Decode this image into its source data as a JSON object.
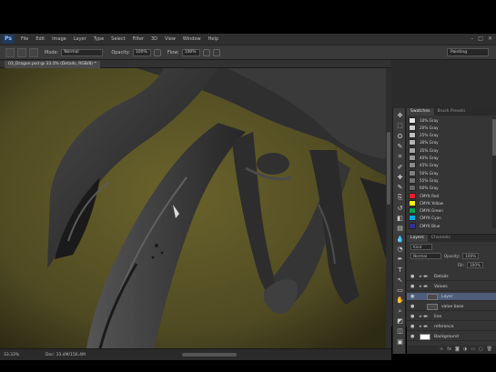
{
  "app": {
    "logo": "Ps",
    "menu": [
      "File",
      "Edit",
      "Image",
      "Layer",
      "Type",
      "Select",
      "Filter",
      "3D",
      "View",
      "Window",
      "Help"
    ],
    "window_controls": [
      "–",
      "□",
      "✕"
    ]
  },
  "options_bar": {
    "mode_label": "Mode:",
    "mode_value": "Normal",
    "opacity_label": "Opacity:",
    "opacity_value": "100%",
    "flow_label": "Flow:",
    "flow_value": "100%",
    "workspace": "Painting"
  },
  "document": {
    "tab_title": "03_Dragon.psd @ 33.3% (Details, RGB/8) *"
  },
  "status": {
    "zoom": "33.33%",
    "doc_size": "Doc: 33.4M/156.4M"
  },
  "tools": [
    "move-icon",
    "marquee-icon",
    "lasso-icon",
    "quick-select-icon",
    "crop-icon",
    "eyedropper-icon",
    "healing-icon",
    "brush-icon",
    "clone-stamp-icon",
    "history-brush-icon",
    "eraser-icon",
    "gradient-icon",
    "blur-icon",
    "dodge-icon",
    "pen-icon",
    "type-icon",
    "path-select-icon",
    "shape-icon",
    "hand-icon",
    "zoom-icon",
    "color-swatch-icon",
    "quick-mask-icon",
    "screen-mode-icon"
  ],
  "tool_glyphs": [
    "✥",
    "⬚",
    "ʘ",
    "✎",
    "⌗",
    "✐",
    "✚",
    "✎",
    "⎘",
    "↺",
    "◧",
    "▤",
    "💧",
    "◔",
    "✒",
    "T",
    "↖",
    "▭",
    "✋",
    "⌕",
    "◩",
    "◫",
    "▣"
  ],
  "swatches_panel": {
    "tabs": [
      "Swatches",
      "Brush Presets"
    ],
    "rows": [
      {
        "label": "10% Gray",
        "color": "#e6e6e6"
      },
      {
        "label": "20% Gray",
        "color": "#cccccc"
      },
      {
        "label": "25% Gray",
        "color": "#bfbfbf"
      },
      {
        "label": "30% Gray",
        "color": "#b3b3b3"
      },
      {
        "label": "35% Gray",
        "color": "#a6a6a6"
      },
      {
        "label": "40% Gray",
        "color": "#999999"
      },
      {
        "label": "45% Gray",
        "color": "#8c8c8c"
      },
      {
        "label": "50% Gray",
        "color": "#808080"
      },
      {
        "label": "55% Gray",
        "color": "#737373"
      },
      {
        "label": "60% Gray",
        "color": "#666666"
      },
      {
        "label": "CMYK Red",
        "color": "#ed1c24"
      },
      {
        "label": "CMYK Yellow",
        "color": "#fff200"
      },
      {
        "label": "CMYK Green",
        "color": "#00a651"
      },
      {
        "label": "CMYK Cyan",
        "color": "#00aeef"
      },
      {
        "label": "CMYK Blue",
        "color": "#2e3192"
      }
    ]
  },
  "layers_panel": {
    "tabs": [
      "Layers",
      "Channels"
    ],
    "kind": "Kind",
    "blend": "Normal",
    "opacity_label": "Opacity:",
    "opacity_value": "100%",
    "fill_label": "Fill:",
    "fill_value": "100%",
    "layers": [
      {
        "name": "Details",
        "type": "group",
        "indent": 0,
        "selected": false
      },
      {
        "name": "Values",
        "type": "group",
        "indent": 0,
        "selected": false
      },
      {
        "name": "Layer",
        "type": "layer",
        "indent": 1,
        "selected": true
      },
      {
        "name": "value base",
        "type": "layer",
        "indent": 1,
        "selected": false
      },
      {
        "name": "line",
        "type": "group",
        "indent": 0,
        "selected": false
      },
      {
        "name": "reference",
        "type": "group",
        "indent": 0,
        "selected": false
      },
      {
        "name": "Background",
        "type": "layer",
        "indent": 0,
        "selected": false
      }
    ],
    "footer_icons": [
      "link-icon",
      "fx-icon",
      "mask-icon",
      "adjustment-icon",
      "folder-icon",
      "new-layer-icon",
      "trash-icon"
    ],
    "footer_glyphs": [
      "∞",
      "fx",
      "◙",
      "◑",
      "▭",
      "▢",
      "🗑"
    ]
  },
  "colors": {
    "canvas_bg": "#555024",
    "selection": "#4d5d7a",
    "panel_bg": "#353535"
  }
}
